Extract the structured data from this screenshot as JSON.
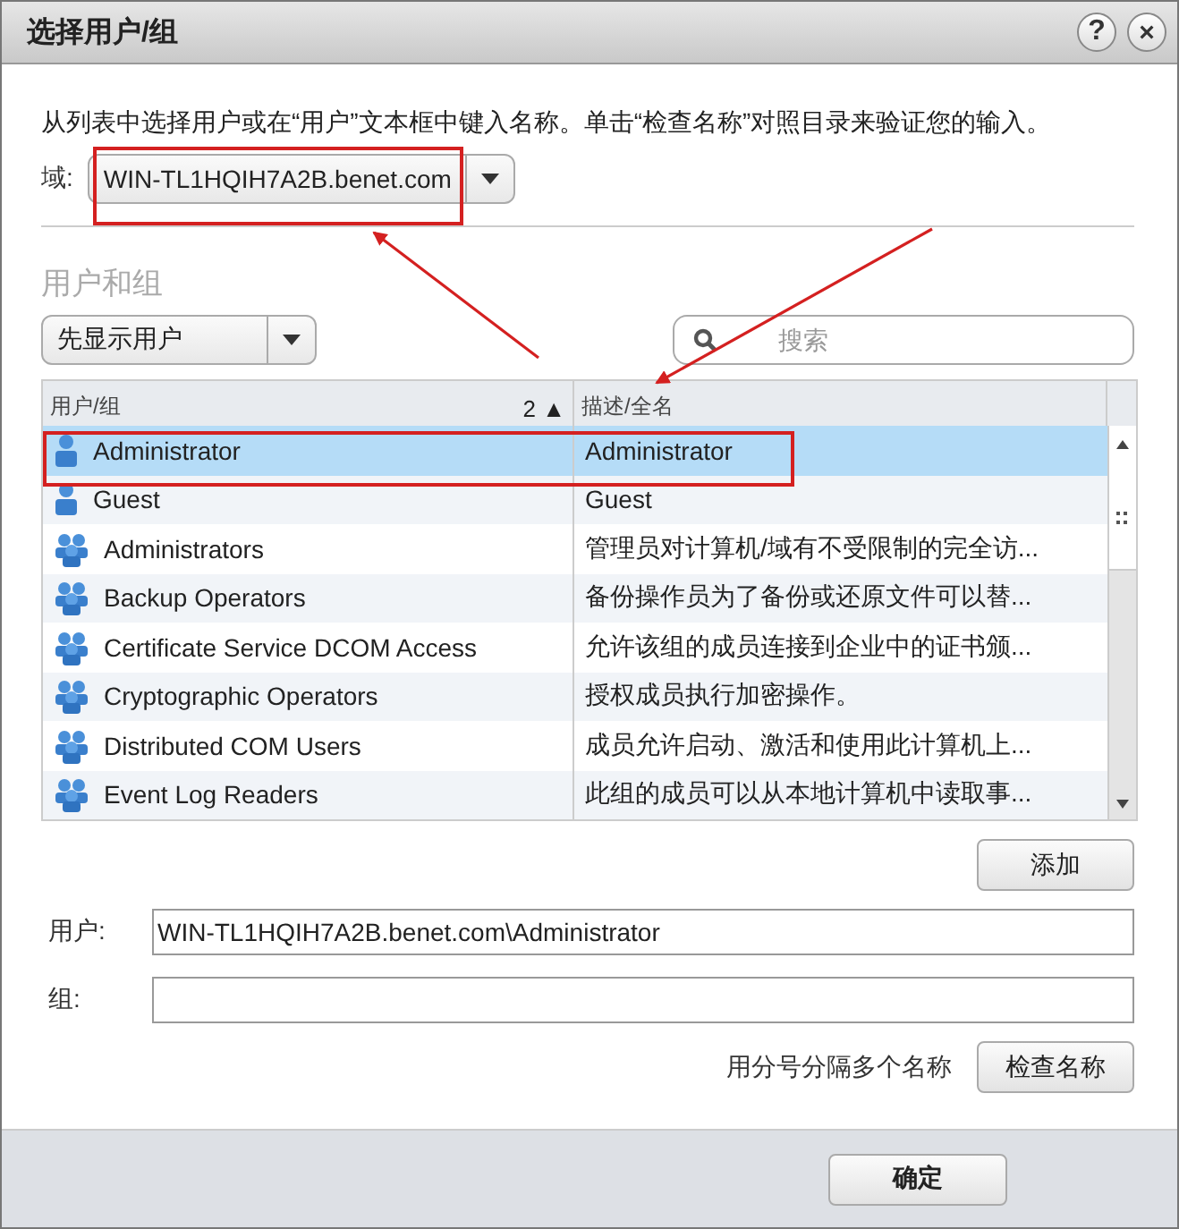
{
  "window": {
    "title": "选择用户/组",
    "buttons": [
      {
        "kind": "help",
        "label": "?"
      },
      {
        "kind": "close",
        "label": "×"
      }
    ]
  },
  "instruction": "从列表中选择用户或在“用户”文本框中键入名称。单击“检查名称”对照目录来验证您的输入。",
  "domain": {
    "label": "域:",
    "value": "WIN-TL1HQIH7A2B.benet.com"
  },
  "section_title": "用户和组",
  "filter": {
    "value": "先显示用户"
  },
  "search": {
    "placeholder": "搜索"
  },
  "table": {
    "columns": [
      {
        "label": "用户/组",
        "sort": "2 ▲"
      },
      {
        "label": "描述/全名"
      }
    ],
    "rows": [
      {
        "kind": "user",
        "name": "Administrator",
        "description": "Administrator",
        "selected": true
      },
      {
        "kind": "user",
        "name": "Guest",
        "description": "Guest",
        "selected": false
      },
      {
        "kind": "group",
        "name": "Administrators",
        "description": "管理员对计算机/域有不受限制的完全访...",
        "selected": false
      },
      {
        "kind": "group",
        "name": "Backup Operators",
        "description": "备份操作员为了备份或还原文件可以替...",
        "selected": false
      },
      {
        "kind": "group",
        "name": "Certificate Service DCOM Access",
        "description": "允许该组的成员连接到企业中的证书颁...",
        "selected": false
      },
      {
        "kind": "group",
        "name": "Cryptographic Operators",
        "description": "授权成员执行加密操作。",
        "selected": false
      },
      {
        "kind": "group",
        "name": "Distributed COM Users",
        "description": "成员允许启动、激活和使用此计算机上...",
        "selected": false
      },
      {
        "kind": "group",
        "name": "Event Log Readers",
        "description": "此组的成员可以从本地计算机中读取事...",
        "selected": false
      }
    ]
  },
  "add_button": "添加",
  "users_field": {
    "label": "用户:",
    "value": "WIN-TL1HQIH7A2B.benet.com\\Administrator"
  },
  "groups_field": {
    "label": "组:"
  },
  "hint": "用分号分隔多个名称",
  "check_button": "检查名称",
  "ok_button": "确定"
}
